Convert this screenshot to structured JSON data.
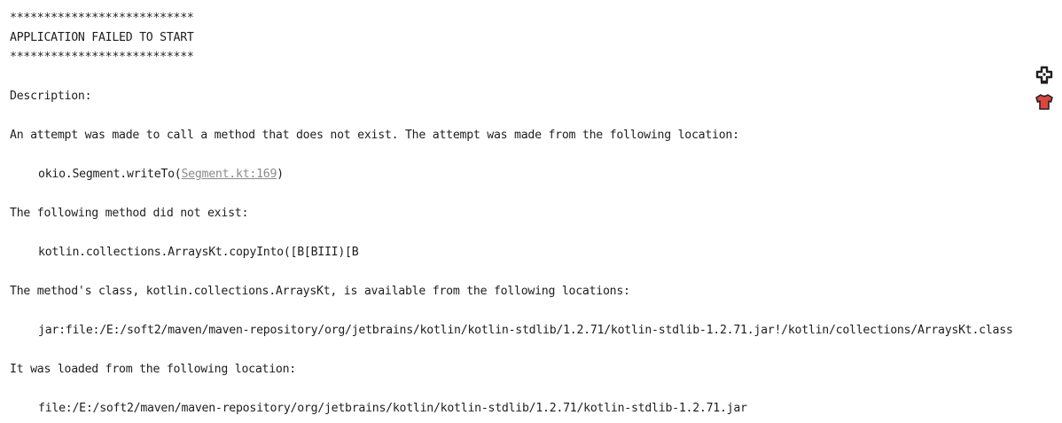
{
  "console": {
    "banner_top": "***************************",
    "title": "APPLICATION FAILED TO START",
    "banner_bottom": "***************************",
    "description_label": "Description:",
    "attempt_text": "An attempt was made to call a method that does not exist. The attempt was made from the following location:",
    "location_prefix": "okio.Segment.writeTo(",
    "location_link": "Segment.kt:169",
    "location_suffix": ")",
    "missing_method_label": "The following method did not exist:",
    "missing_method": "kotlin.collections.ArraysKt.copyInto([B[BIII)[B",
    "class_available_text": "The method's class, kotlin.collections.ArraysKt, is available from the following locations:",
    "class_location": "jar:file:/E:/soft2/maven/maven-repository/org/jetbrains/kotlin/kotlin-stdlib/1.2.71/kotlin-stdlib-1.2.71.jar!/kotlin/collections/ArraysKt.class",
    "loaded_from_text": "It was loaded from the following location:",
    "loaded_location": "file:/E:/soft2/maven/maven-repository/org/jetbrains/kotlin/kotlin-stdlib/1.2.71/kotlin-stdlib-1.2.71.jar"
  },
  "side_icons": [
    {
      "name": "plugin-icon",
      "color": "#1e1e1e"
    },
    {
      "name": "shirt-icon",
      "color": "#e0443e"
    }
  ]
}
